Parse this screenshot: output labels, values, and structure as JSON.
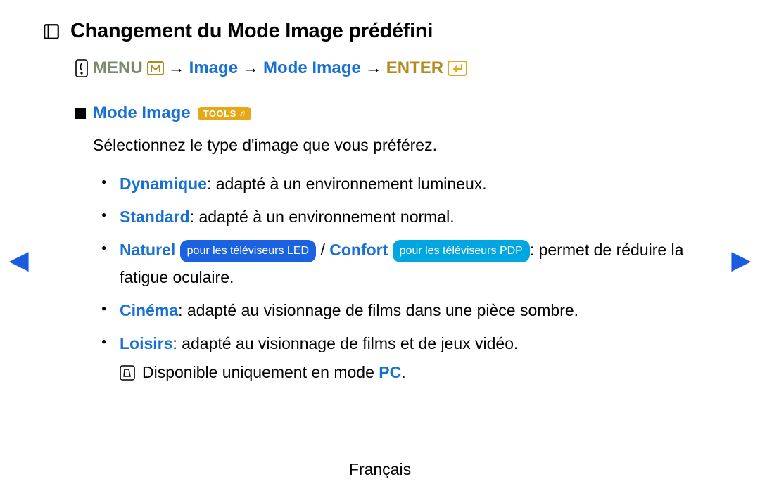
{
  "title": "Changement du Mode Image prédéfini",
  "breadcrumb": {
    "menu": "MENU",
    "path1": "Image",
    "path2": "Mode Image",
    "enter": "ENTER",
    "arrow": "→"
  },
  "section": {
    "title": "Mode Image",
    "tools_badge": "TOOLS",
    "intro": "Sélectionnez le type d'image que vous préférez.",
    "items": {
      "dynamique": {
        "label": "Dynamique",
        "desc": ": adapté à un environnement lumineux."
      },
      "standard": {
        "label": "Standard",
        "desc": ": adapté à un environnement normal."
      },
      "naturel": {
        "label": "Naturel",
        "pill": "pour les téléviseurs LED"
      },
      "confort": {
        "label": "Confort",
        "pill": "pour les téléviseurs PDP",
        "desc": ": permet de réduire la fatigue oculaire.",
        "sep": " / "
      },
      "cinema": {
        "label": "Cinéma",
        "desc": ": adapté au visionnage de films dans une pièce sombre."
      },
      "loisirs": {
        "label": "Loisirs",
        "desc": ": adapté au visionnage de films et de jeux vidéo."
      }
    },
    "note_prefix": "Disponible uniquement en mode ",
    "note_suffix": "PC",
    "note_period": "."
  },
  "footer": {
    "lang": "Français"
  },
  "nav": {
    "left": "◀",
    "right": "▶"
  }
}
